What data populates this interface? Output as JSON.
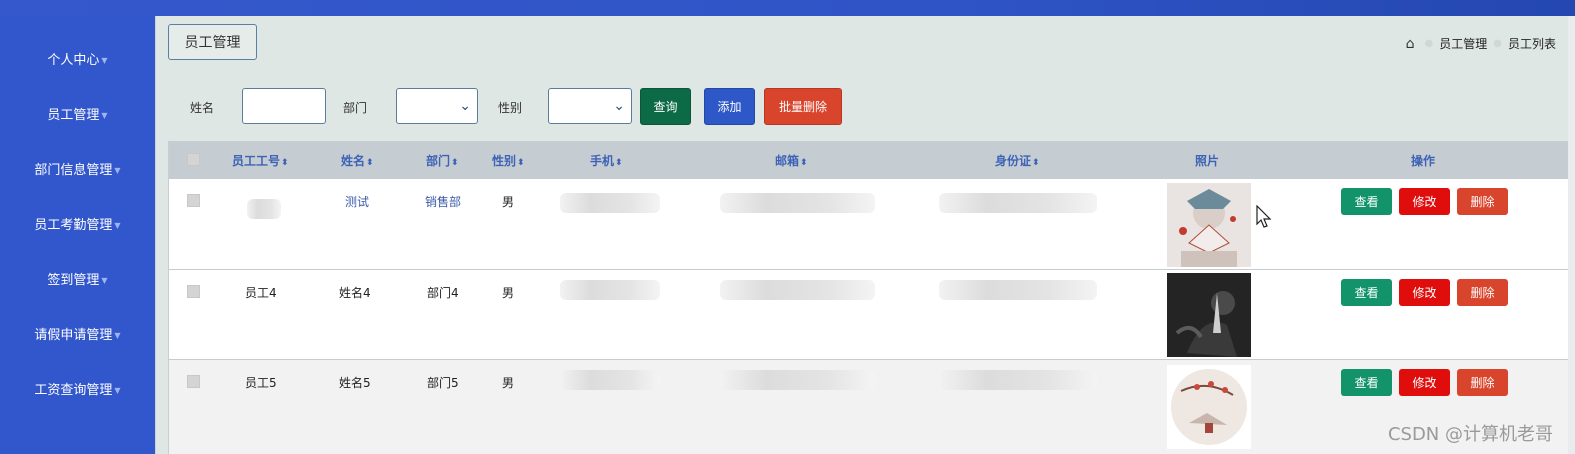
{
  "sidebar": {
    "items": [
      {
        "label": "个人中心"
      },
      {
        "label": "员工管理"
      },
      {
        "label": "部门信息管理"
      },
      {
        "label": "员工考勤管理"
      },
      {
        "label": "签到管理"
      },
      {
        "label": "请假申请管理"
      },
      {
        "label": "工资查询管理"
      }
    ]
  },
  "header": {
    "title": "员工管理",
    "breadcrumb": [
      "员工管理",
      "员工列表"
    ]
  },
  "filters": {
    "name_label": "姓名",
    "name_value": "",
    "dept_label": "部门",
    "dept_value": "",
    "gender_label": "性别",
    "gender_value": ""
  },
  "actions": {
    "query": "查询",
    "add": "添加",
    "bulk_delete": "批量删除"
  },
  "table": {
    "columns": [
      "员工工号",
      "姓名",
      "部门",
      "性别",
      "手机",
      "邮箱",
      "身份证",
      "照片",
      "操作"
    ],
    "rows": [
      {
        "emp_no": "",
        "name": "测试",
        "dept": "销售部",
        "gender": "男"
      },
      {
        "emp_no": "员工4",
        "name": "姓名4",
        "dept": "部门4",
        "gender": "男"
      },
      {
        "emp_no": "员工5",
        "name": "姓名5",
        "dept": "部门5",
        "gender": "男"
      }
    ],
    "row_actions": {
      "view": "查看",
      "edit": "修改",
      "delete": "删除"
    }
  },
  "watermark": "CSDN @计算机老哥",
  "colors": {
    "sidebar": "#3257cc",
    "query": "#0c6b46",
    "add": "#2e57c8",
    "bulk": "#d9452c",
    "view": "#12936a",
    "edit": "#e00d0d"
  }
}
